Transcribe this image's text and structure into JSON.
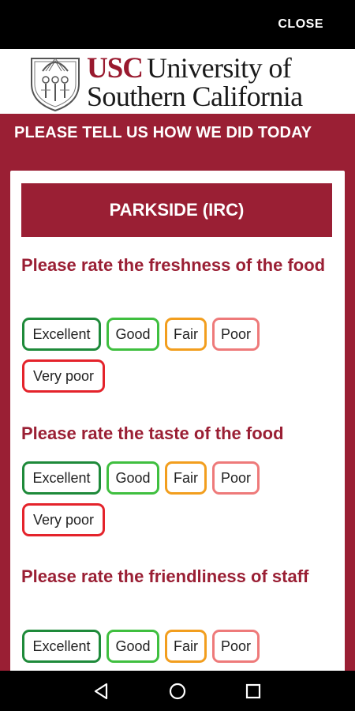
{
  "topbar": {
    "close_label": "CLOSE"
  },
  "logo": {
    "usc": "USC",
    "university_line1": "University of",
    "university_line2": "Southern California"
  },
  "survey": {
    "header": "PLEASE TELL US HOW WE DID TODAY",
    "venue": "PARKSIDE (IRC)",
    "questions": [
      {
        "text": "Please rate the freshness of the food",
        "options": [
          "Excellent",
          "Good",
          "Fair",
          "Poor",
          "Very poor"
        ]
      },
      {
        "text": "Please rate the taste of the food",
        "options": [
          "Excellent",
          "Good",
          "Fair",
          "Poor",
          "Very poor"
        ]
      },
      {
        "text": "Please rate the friendliness of staff",
        "options": [
          "Excellent",
          "Good",
          "Fair",
          "Poor"
        ]
      }
    ]
  },
  "colors": {
    "brand_maroon": "#9a1f34",
    "excellent": "#1e8a3a",
    "good": "#3fbf3f",
    "fair": "#f29e1e",
    "poor": "#ee7a7a",
    "very_poor": "#e4232b"
  },
  "navbar": {
    "icons": [
      "back-icon",
      "home-icon",
      "recents-icon"
    ]
  }
}
